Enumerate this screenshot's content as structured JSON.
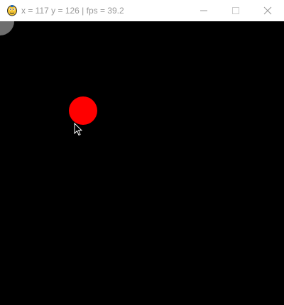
{
  "window": {
    "title": "x = 117 y = 126 | fps = 39.2",
    "app_icon": "pygame-snake-icon",
    "controls": [
      "minimize-icon",
      "maximize-icon",
      "close-icon"
    ]
  },
  "canvas": {
    "background_color": "#000000",
    "ball_color": "#ff0000",
    "corner_color": "#6e6e6e"
  }
}
